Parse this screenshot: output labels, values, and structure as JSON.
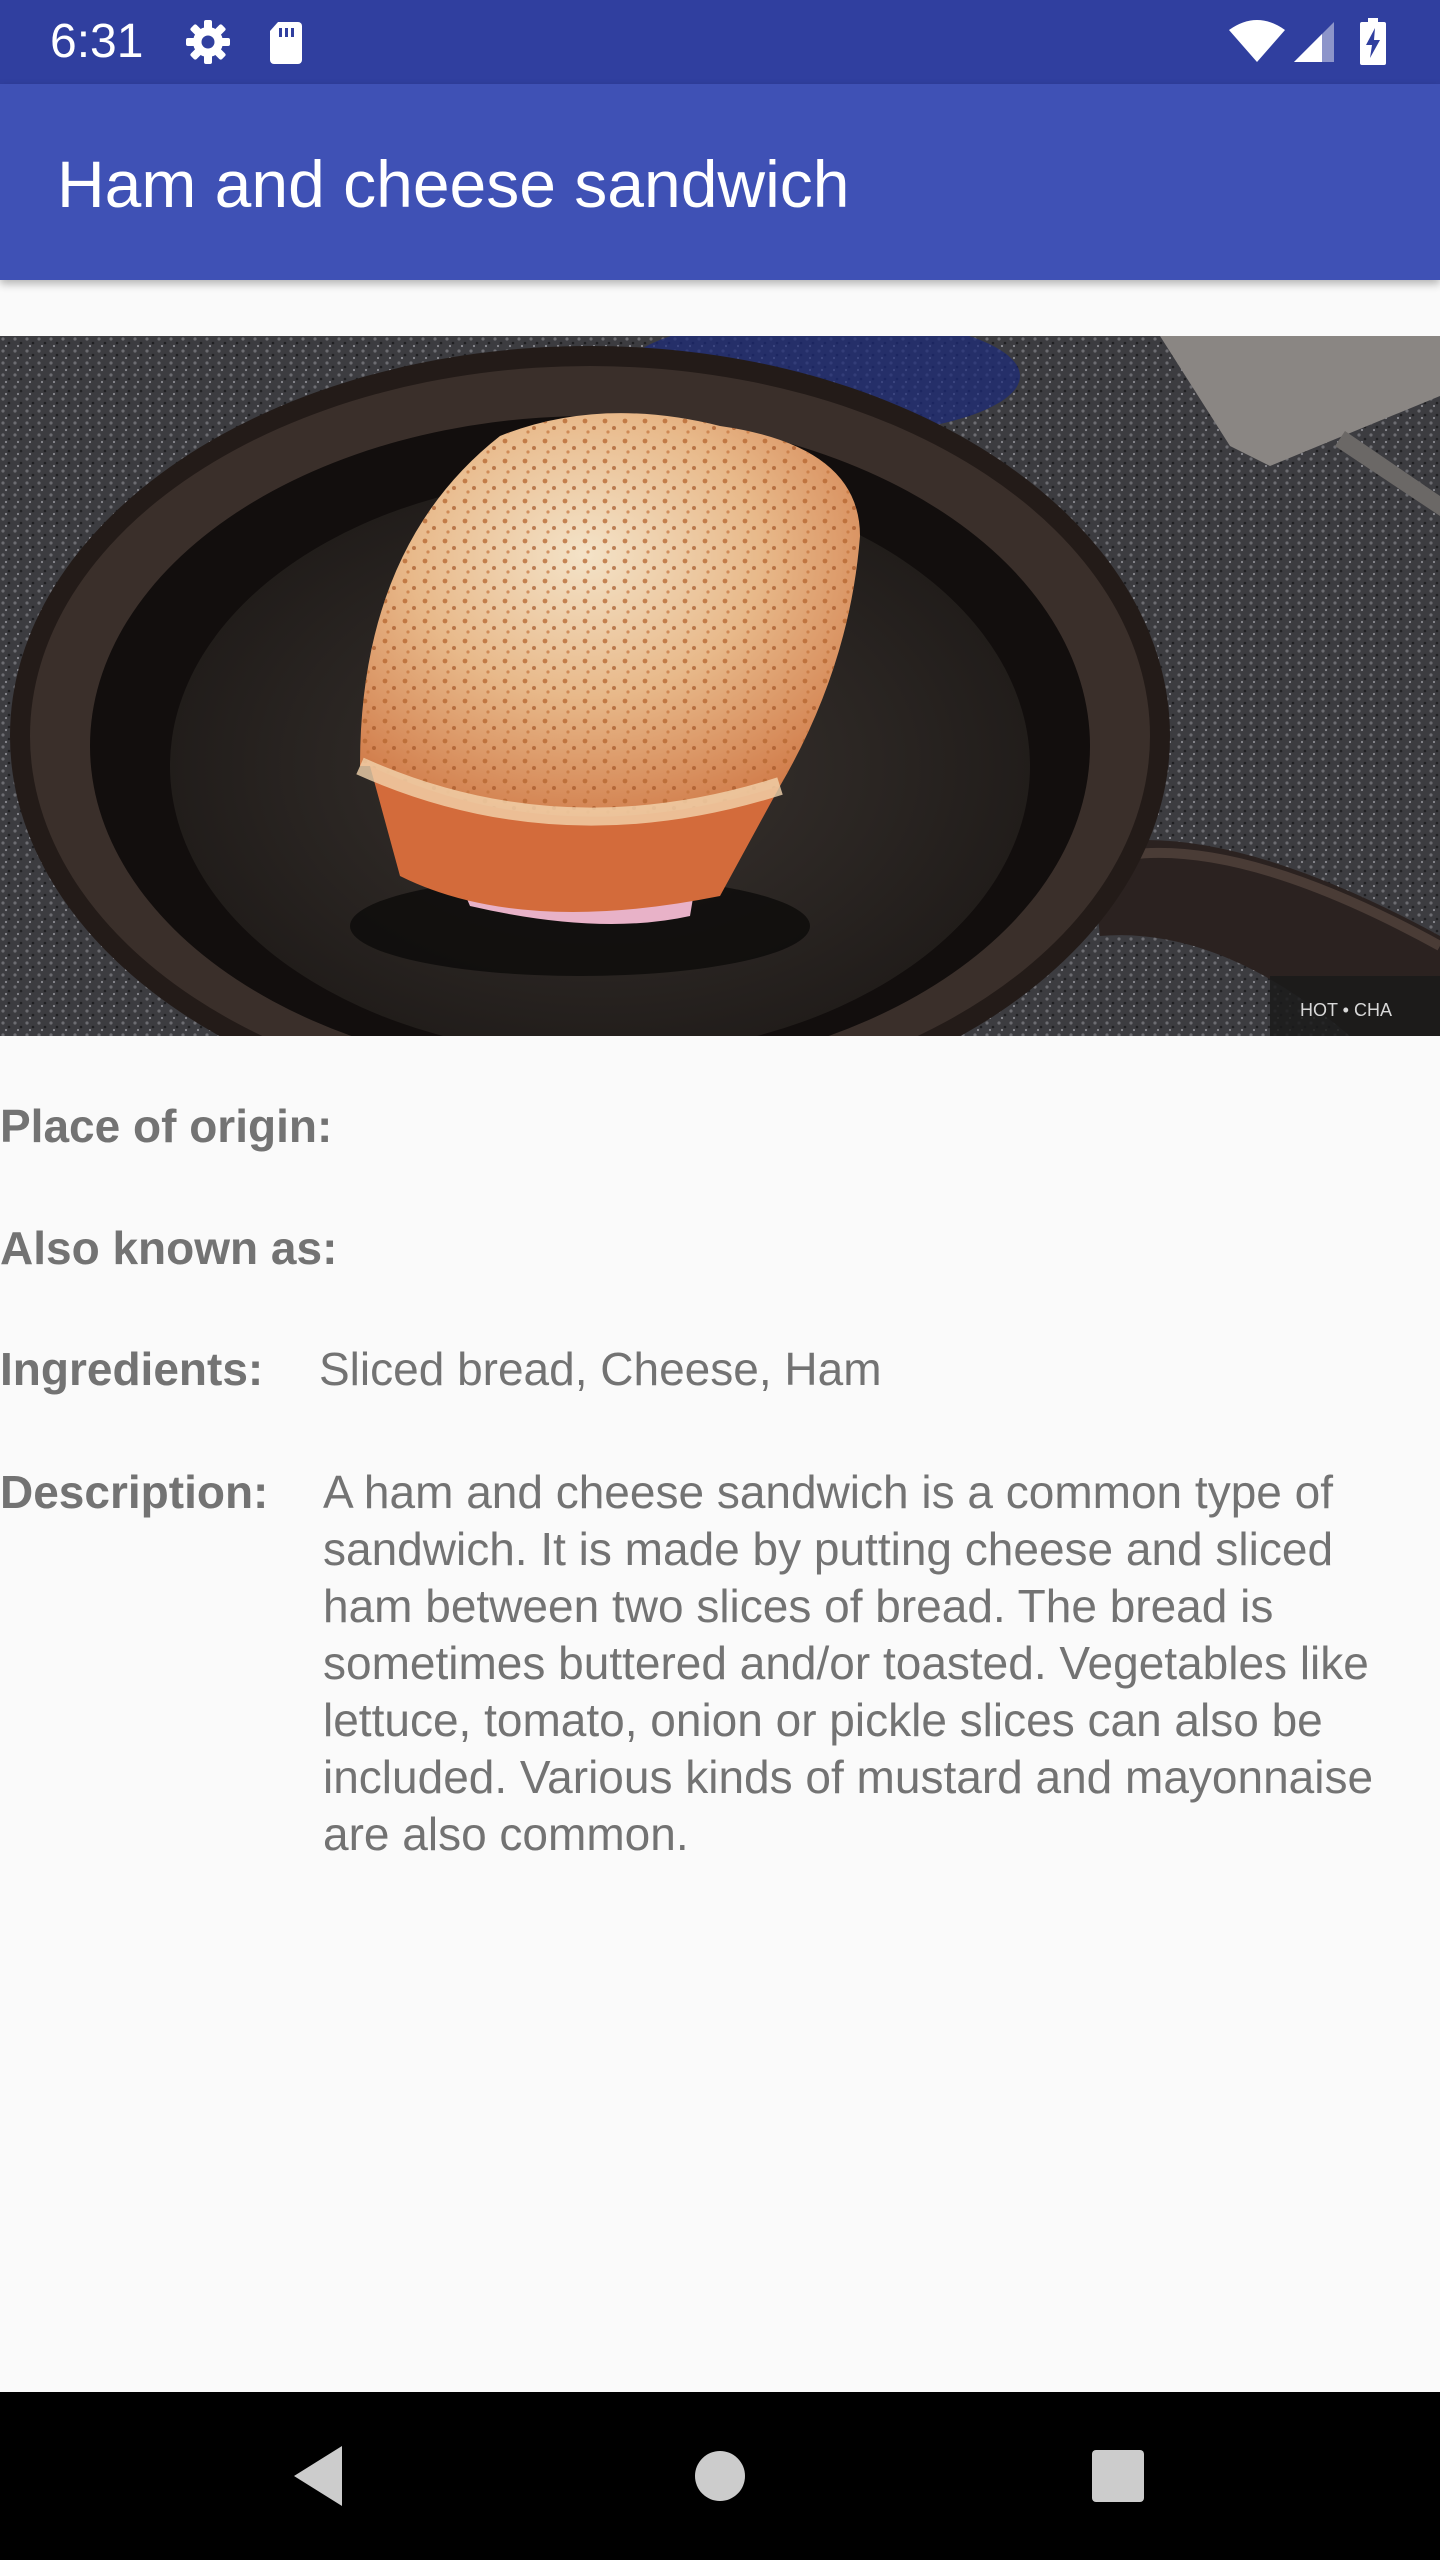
{
  "status_bar": {
    "time": "6:31",
    "icons": [
      "gear-icon",
      "sd-card-icon",
      "wifi-icon",
      "cell-signal-icon",
      "battery-charging-icon"
    ]
  },
  "app_bar": {
    "title": "Ham and cheese sandwich"
  },
  "photo": {
    "icon": "sandwich-photo",
    "watermark": "HOT • CHA"
  },
  "details": {
    "place_of_origin_label": "Place of origin:",
    "place_of_origin_value": "",
    "also_known_as_label": "Also known as:",
    "also_known_as_value": "",
    "ingredients_label": "Ingredients:",
    "ingredients_value": "Sliced bread, Cheese, Ham",
    "description_label": "Description:",
    "description_value": "A ham and cheese sandwich is a common type of sandwich. It is made by putting cheese and sliced ham between two slices of bread. The bread is sometimes buttered and/or toasted. Vegetables like lettuce, tomato, onion or pickle slices can also be included. Various kinds of mustard and mayonnaise are also common."
  },
  "nav_bar": {
    "icons": [
      "back-icon",
      "home-icon",
      "recents-icon"
    ]
  },
  "colors": {
    "status_bar": "#303f9f",
    "app_bar": "#3f51b5",
    "background": "#fafafa",
    "text": "#737373"
  }
}
